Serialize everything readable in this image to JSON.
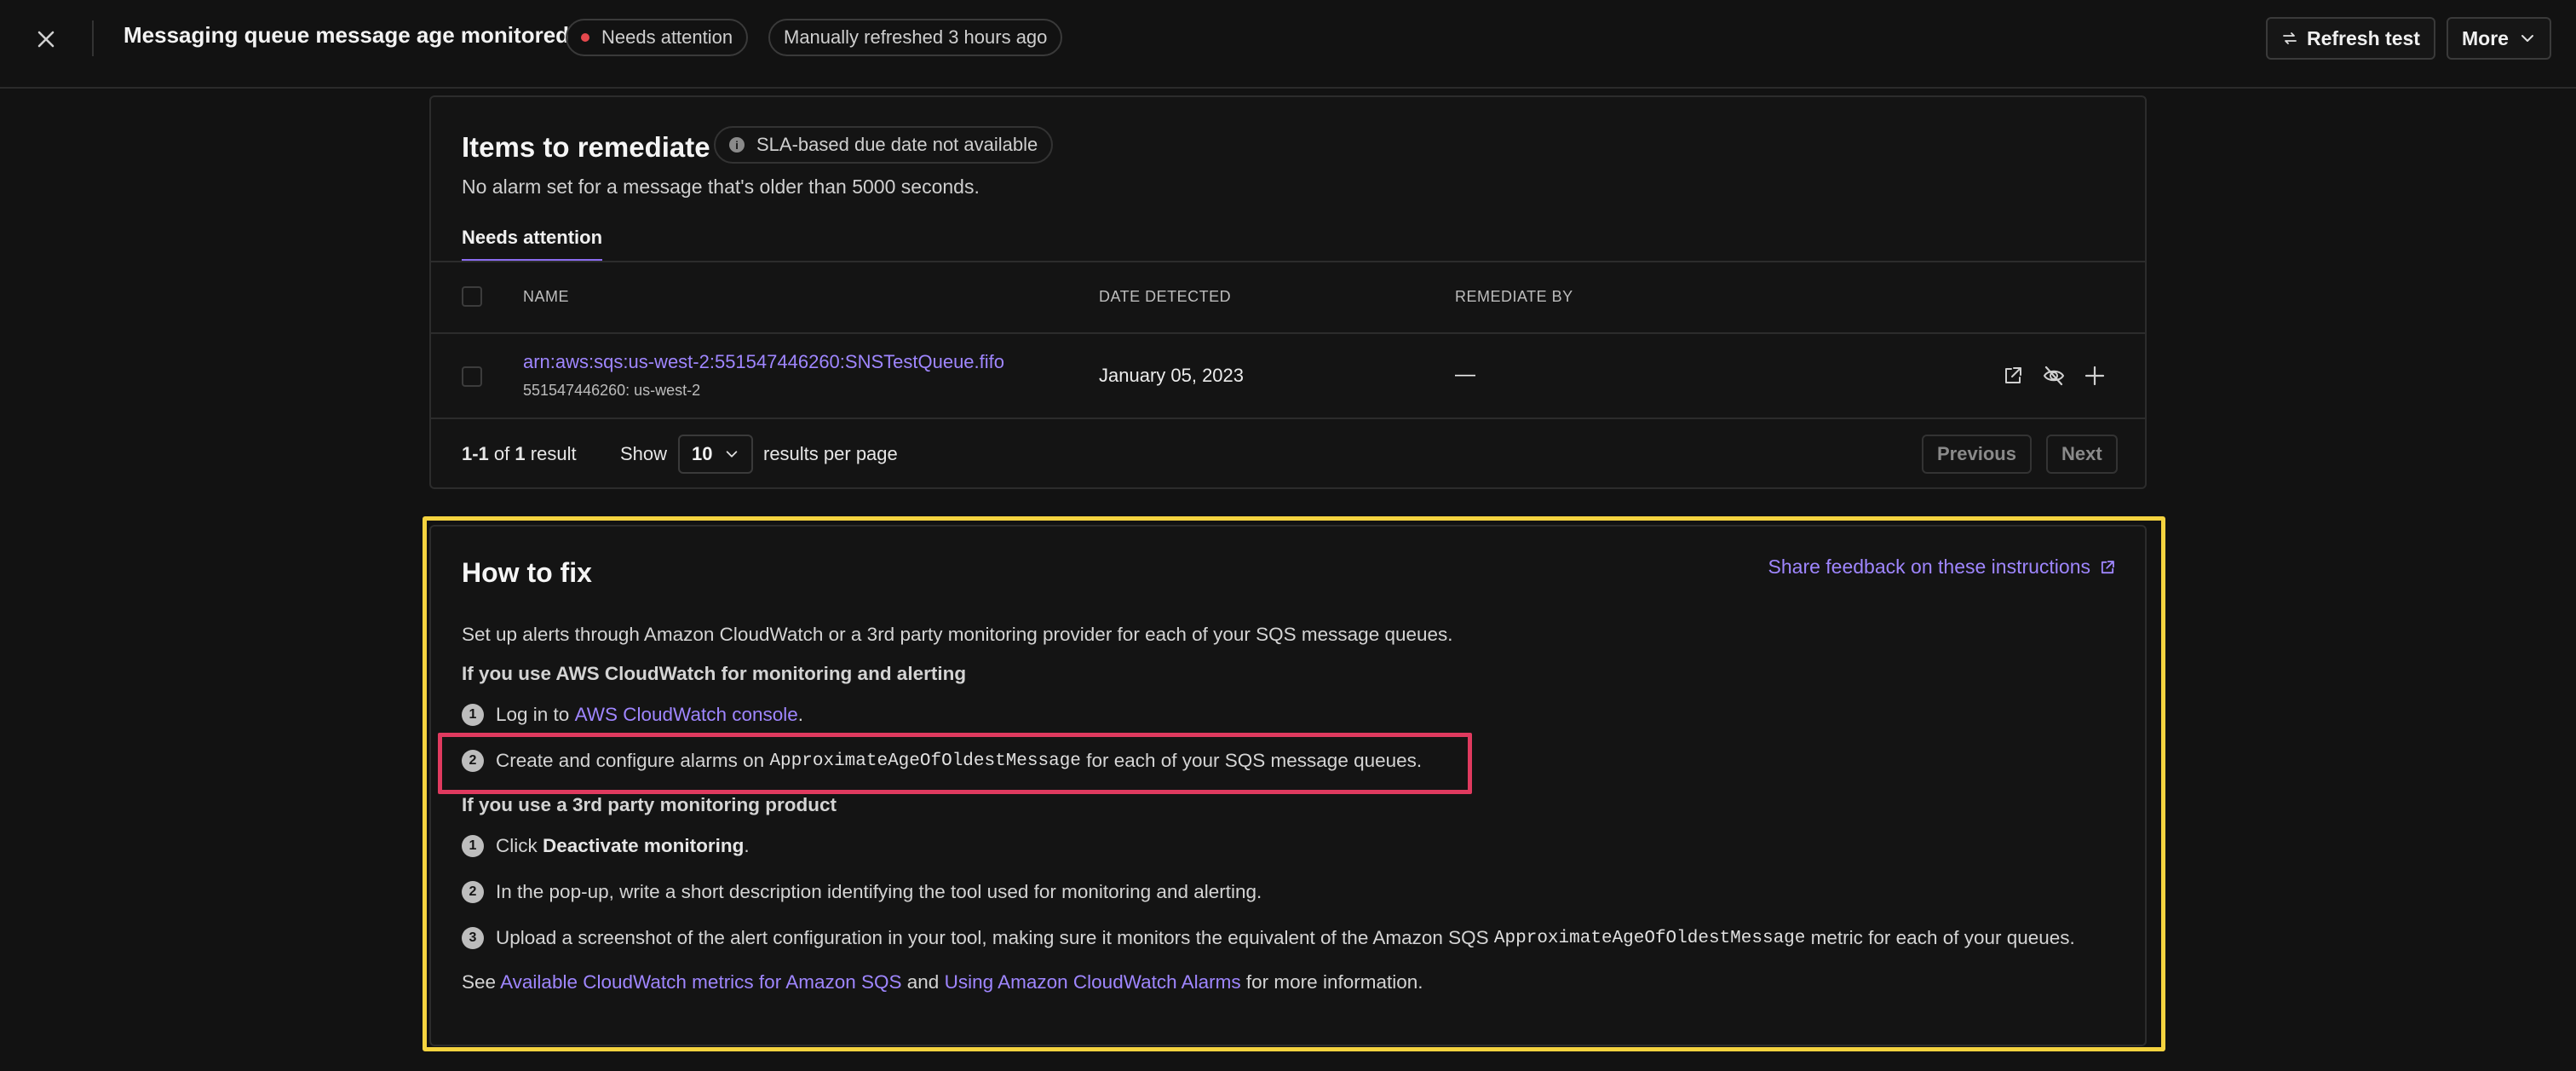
{
  "header": {
    "title": "Messaging queue message age monitored",
    "status_badge": "Needs attention",
    "refresh_status": "Manually refreshed 3 hours ago",
    "refresh_button": "Refresh test",
    "more_button": "More"
  },
  "items": {
    "title": "Items to remediate",
    "sla_badge": "SLA-based due date not available",
    "subtitle": "No alarm set for a message that's older than 5000 seconds.",
    "tab": "Needs attention",
    "columns": {
      "name": "NAME",
      "date": "DATE DETECTED",
      "remediate": "REMEDIATE BY"
    },
    "rows": [
      {
        "name": "arn:aws:sqs:us-west-2:551547446260:SNSTestQueue.fifo",
        "sub": "551547446260: us-west-2",
        "date": "January 05, 2023",
        "remediate_by": "—"
      }
    ],
    "pagination": {
      "range": "1-1",
      "of": "of",
      "total": "1",
      "result_word": "result",
      "show": "Show",
      "per_page_value": "10",
      "per_page_label": "results per page",
      "previous": "Previous",
      "next": "Next"
    }
  },
  "how_to_fix": {
    "title": "How to fix",
    "feedback_link": "Share feedback on these instructions",
    "intro": "Set up alerts through Amazon CloudWatch or a 3rd party monitoring provider for each of your SQS message queues.",
    "section1_heading": "If you use AWS CloudWatch for monitoring and alerting",
    "s1_step1_prefix": "Log in to",
    "s1_step1_link": "AWS CloudWatch console",
    "s1_step1_suffix": ".",
    "s1_step2_prefix": "Create and configure alarms on",
    "s1_step2_code": "ApproximateAgeOfOldestMessage",
    "s1_step2_suffix": "for each of your SQS message queues.",
    "section2_heading": "If you use a 3rd party monitoring product",
    "s2_step1_prefix": "Click",
    "s2_step1_bold": "Deactivate monitoring",
    "s2_step1_suffix": ".",
    "s2_step2": "In the pop-up, write a short description identifying the tool used for monitoring and alerting.",
    "s2_step3_prefix": "Upload a screenshot of the alert configuration in your tool, making sure it monitors the equivalent of the Amazon SQS",
    "s2_step3_code": "ApproximateAgeOfOldestMessage",
    "s2_step3_suffix": "metric for each of your queues.",
    "footer_prefix": "See",
    "footer_link1": "Available CloudWatch metrics for Amazon SQS",
    "footer_and": "and",
    "footer_link2": "Using Amazon CloudWatch Alarms",
    "footer_suffix": "for more information.",
    "step_numbers": [
      "1",
      "2",
      "3"
    ]
  },
  "colors": {
    "accent": "#9f86ff",
    "status_red": "#e5484d",
    "highlight_yellow": "#f5d33f",
    "highlight_red": "#e03a5f"
  },
  "icons": {
    "close": "close-icon",
    "refresh": "refresh-icon",
    "more": "chevron-down-icon",
    "info": "info-icon",
    "external": "external-link-icon",
    "hide": "eye-off-icon",
    "add": "plus-icon"
  }
}
